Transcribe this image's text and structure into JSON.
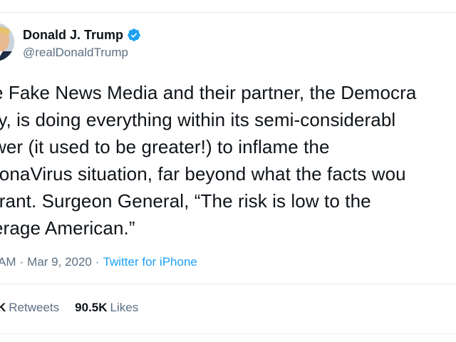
{
  "tweet": {
    "author": {
      "display_name": "Donald J. Trump",
      "handle": "@realDonaldTrump",
      "verified": true,
      "verified_icon": "verified-badge-icon",
      "avatar_icon": "profile-photo"
    },
    "text_lines": [
      "e Fake News Media and their partner, the Democra",
      "ty, is doing everything within its semi-considerabl",
      "wer (it used to be greater!) to inflame the",
      "ronaVirus situation, far beyond what the facts wou",
      "rrant. Surgeon General, “The risk is low to the",
      "erage American.”"
    ],
    "meta": {
      "time": "AM",
      "separator": "·",
      "date": "Mar 9, 2020",
      "source": "Twitter for iPhone"
    },
    "stats": {
      "retweets_count": "K",
      "retweets_label": "Retweets",
      "likes_count": "90.5K",
      "likes_label": "Likes"
    }
  },
  "colors": {
    "text": "#0f1419",
    "secondary": "#5b7083",
    "accent": "#1da1f2",
    "divider": "#e6ecf0"
  }
}
